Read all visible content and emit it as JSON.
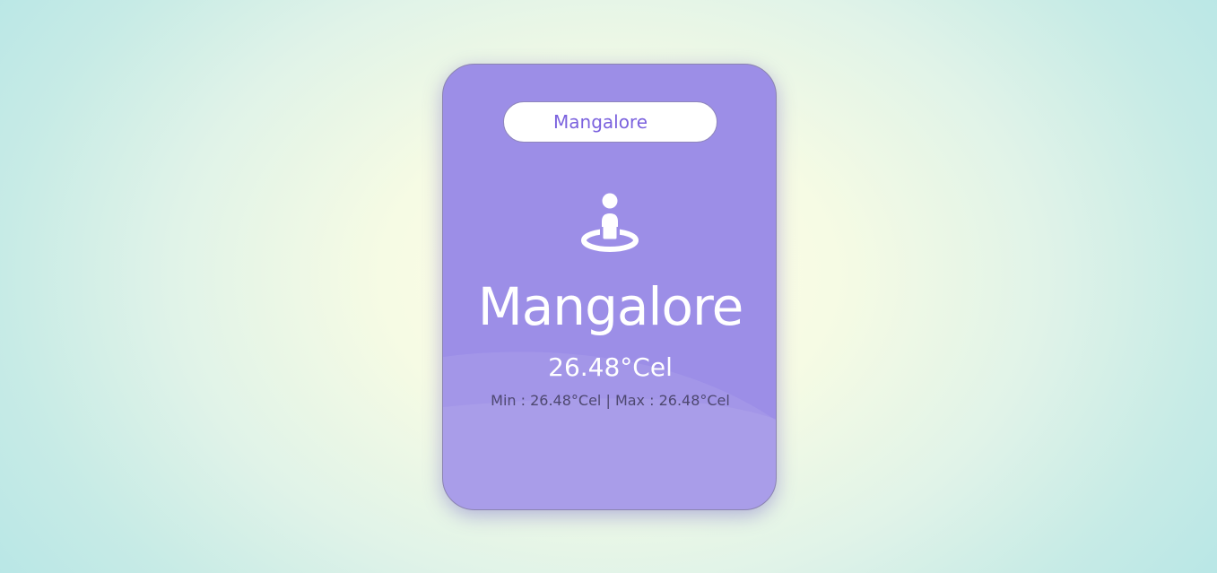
{
  "search": {
    "value": "Mangalore",
    "placeholder": ""
  },
  "icon": "street-view-icon",
  "weather": {
    "city": "Mangalore",
    "temperature": "26.48°Cel",
    "min_max": "Min : 26.48°Cel | Max : 26.48°Cel"
  },
  "colors": {
    "card": "#9c8ee7",
    "accent_text": "#7b62de"
  }
}
